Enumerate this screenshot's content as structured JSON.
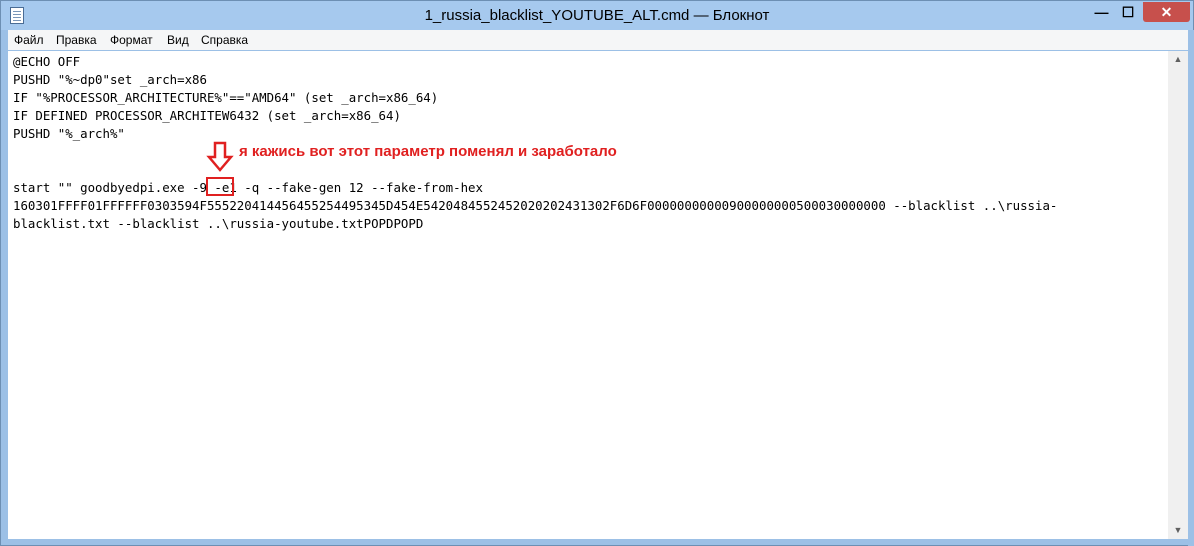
{
  "window": {
    "title": "1_russia_blacklist_YOUTUBE_ALT.cmd — Блокнот",
    "buttons": {
      "minimize": "—",
      "maximize": "☐",
      "close": "✕"
    }
  },
  "menu": {
    "items": [
      {
        "label": "Файл"
      },
      {
        "label": "Правка"
      },
      {
        "label": "Формат"
      },
      {
        "label": "Вид"
      },
      {
        "label": "Справка"
      }
    ]
  },
  "editor": {
    "lines": [
      "@ECHO OFF",
      "PUSHD \"%~dp0\"set _arch=x86",
      "IF \"%PROCESSOR_ARCHITECTURE%\"==\"AMD64\" (set _arch=x86_64)",
      "IF DEFINED PROCESSOR_ARCHITEW6432 (set _arch=x86_64)",
      "PUSHD \"%_arch%\"",
      "",
      "start \"\" goodbyedpi.exe -9 -e1 -q --fake-gen 12 --fake-from-hex",
      "160301FFFF01FFFFFF0303594F555220414456455254495345D454E5420484552452020202431302F6D6F00000000000900000000500030000000 --blacklist ..\\russia-",
      "blacklist.txt --blacklist ..\\russia-youtube.txtPOPDPOPD"
    ]
  },
  "annotation": {
    "text": "я кажись вот этот параметр поменял и заработало",
    "color": "#e02020"
  },
  "scrollbar": {
    "up_icon": "▲",
    "down_icon": "▼"
  },
  "colors": {
    "accent": "#e02020",
    "title_bar": "#a6c9ee",
    "close_button": "#c7504c"
  }
}
